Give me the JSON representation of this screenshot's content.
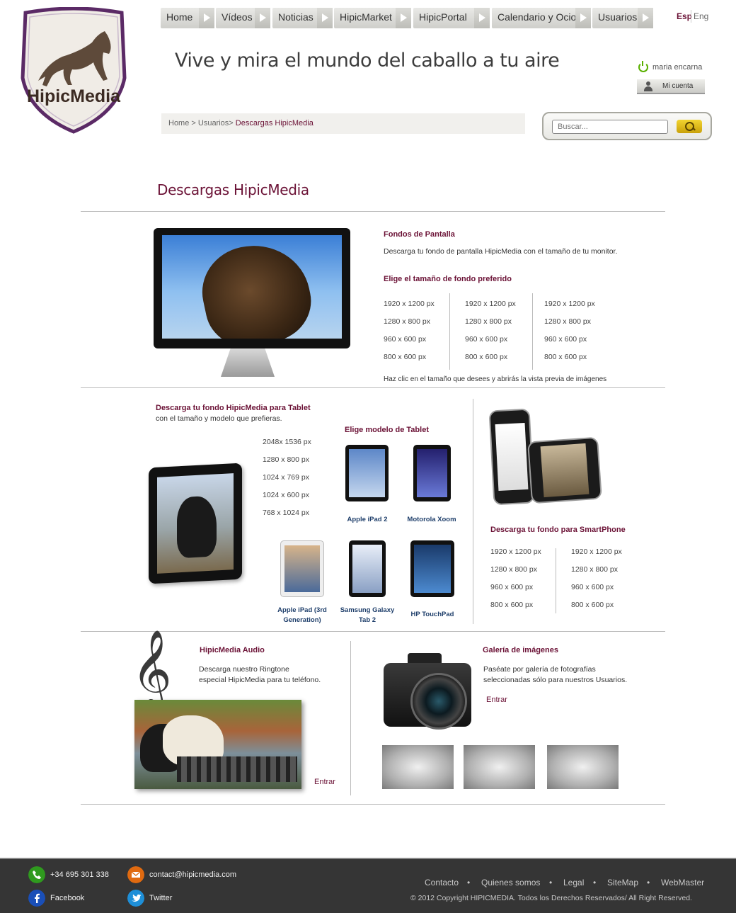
{
  "logo": {
    "text": "HipicMedia"
  },
  "nav": [
    {
      "label": "Home"
    },
    {
      "label": "Vídeos"
    },
    {
      "label": "Noticias"
    },
    {
      "label": "HipicMarket"
    },
    {
      "label": "HipicPortal"
    },
    {
      "label": "Calendario y Ocio"
    },
    {
      "label": "Usuarios"
    }
  ],
  "lang": {
    "es": "Esp",
    "en": "Eng"
  },
  "tagline": "Vive y mira el mundo del caballo a tu aire",
  "user": {
    "name": "maria encarna",
    "account_label": "Mi cuenta"
  },
  "breadcrumb": {
    "trail": "Home > Usuarios> ",
    "current": "Descargas HipicMedia"
  },
  "search": {
    "placeholder": "Buscar..."
  },
  "page_title": "Descargas HipicMedia",
  "wallpapers": {
    "title": "Fondos de Pantalla",
    "description": "Descarga tu fondo de pantalla HipicMedia con el tamaño de tu monitor.",
    "choose_label": "Elige el tamaño de fondo preferido",
    "columns": [
      [
        "1920 x 1200 px",
        "1280 x 800 px",
        "960 x 600 px",
        "800 x 600 px"
      ],
      [
        "1920 x 1200 px",
        "1280 x 800 px",
        "960 x 600 px",
        "800 x 600 px"
      ],
      [
        "1920 x 1200 px",
        "1280 x 800 px",
        "960 x 600 px",
        "800 x 600 px"
      ]
    ],
    "hint": "Haz clic en el tamaño que desees y abrirás la vista previa de imágenes"
  },
  "tablet": {
    "title": "Descarga tu fondo HipicMedia para Tablet",
    "subtitle": "con el tamaño y modelo que prefieras.",
    "sizes": [
      "2048x 1536 px",
      "1280 x 800 px",
      "1024 x 769 px",
      "1024 x 600 px",
      "768 x 1024  px"
    ],
    "choose_model": "Elige modelo de Tablet",
    "models": [
      {
        "name": "Apple iPad 2"
      },
      {
        "name": "Motorola Xoom"
      },
      {
        "name_line1": "Apple iPad (3rd",
        "name_line2": "Generation)"
      },
      {
        "name_line1": "Samsung Galaxy",
        "name_line2": "Tab 2"
      },
      {
        "name": "HP TouchPad"
      }
    ]
  },
  "smartphone": {
    "title": "Descarga tu fondo para SmartPhone",
    "columns": [
      [
        "1920 x 1200 px",
        "1280 x 800 px",
        "960 x 600 px",
        "800 x 600 px"
      ],
      [
        "1920 x 1200 px",
        "1280 x 800 px",
        "960 x 600 px",
        "800 x 600 px"
      ]
    ]
  },
  "audio": {
    "title": "HipicMedia Audio",
    "line1": "Descarga nuestro Ringtone",
    "line2": "especial  HipicMedia para tu teléfono.",
    "cta": "Entrar"
  },
  "gallery": {
    "title": "Galería de imágenes",
    "line1": "Paséate por galería de fotografías",
    "line2": "seleccionadas sólo para nuestros Usuarios.",
    "cta": "Entrar"
  },
  "footer": {
    "phone": "+34 695 301 338",
    "email": "contact@hipicmedia.com",
    "facebook": "Facebook",
    "twitter": "Twitter",
    "links": [
      "Contacto",
      "Quienes somos",
      "Legal",
      "SiteMap",
      "WebMaster"
    ],
    "copyright": "© 2012 Copyright HIPICMEDIA. Todos los Derechos Reservados/ All Right Reserved."
  },
  "colors": {
    "brand": "#6b1236",
    "footer_bg": "#353535",
    "search_button": "#e0bc14",
    "phone_icon": "#2f9a1e",
    "email_icon": "#e06a10",
    "facebook_icon": "#1a4fb8",
    "twitter_icon": "#1e8fd8"
  }
}
